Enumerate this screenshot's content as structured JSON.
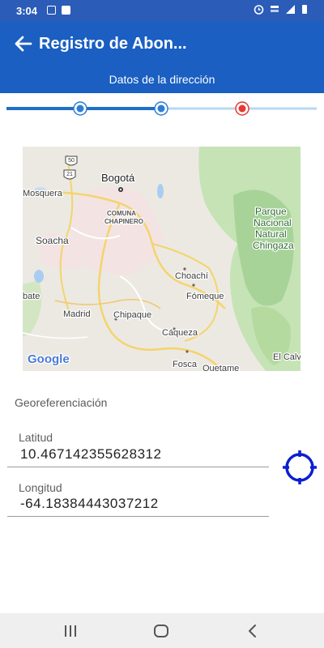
{
  "status_bar": {
    "time": "3:04",
    "icons": [
      "media-icon",
      "app-icon",
      "alarm-icon",
      "lte-icon",
      "signal-icon",
      "battery-icon"
    ]
  },
  "app_bar": {
    "title": "Registro de Abon...",
    "subtitle": "Datos de la dirección",
    "color": "#1a5fc1"
  },
  "stepper": {
    "steps": [
      {
        "state": "completed",
        "color": "#2d7fd6"
      },
      {
        "state": "completed",
        "color": "#2d7fd6"
      },
      {
        "state": "current",
        "color": "#e53935"
      }
    ]
  },
  "map": {
    "labels": {
      "mosquera": "Mosquera",
      "bogota": "Bogotá",
      "comuna": "COMUNA",
      "chapinero": "CHAPINERO",
      "soacha": "Soacha",
      "parque1": "Parque",
      "parque2": "Nacional",
      "parque3": "Natural",
      "parque4": "Chingaza",
      "choachi": "Choachí",
      "fomeque": "Fómeque",
      "bate": "bate",
      "madrid": "Madrid",
      "chipaque": "Chipaque",
      "caqueza": "Cáqueza",
      "elcalv": "El Calv",
      "fosca": "Fosca",
      "quetame": "Quetame",
      "shield50": "50",
      "shield21": "21"
    },
    "logo": "Google"
  },
  "georef": {
    "section_label": "Georeferenciación",
    "latitude_label": "Latitud",
    "latitude_value": "10.467142355628312",
    "longitude_label": "Longitud",
    "longitude_value": "-64.18384443037212",
    "gps_color": "#0b1fd1"
  }
}
